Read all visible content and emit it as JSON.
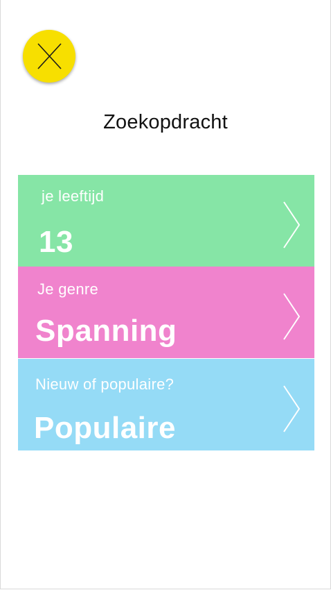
{
  "page": {
    "title": "Zoekopdracht"
  },
  "close_button": {
    "icon": "close-icon",
    "color": "#f7df00"
  },
  "cards": [
    {
      "label": "je leeftijd",
      "value": "13",
      "color": "#86e5a6",
      "icon": "chevron-right-icon"
    },
    {
      "label": "Je genre",
      "value": "Spanning",
      "color": "#f083cd",
      "icon": "chevron-right-icon"
    },
    {
      "label": "Nieuw of populaire?",
      "value": "Populaire",
      "color": "#95dbf6",
      "icon": "chevron-right-icon"
    }
  ]
}
